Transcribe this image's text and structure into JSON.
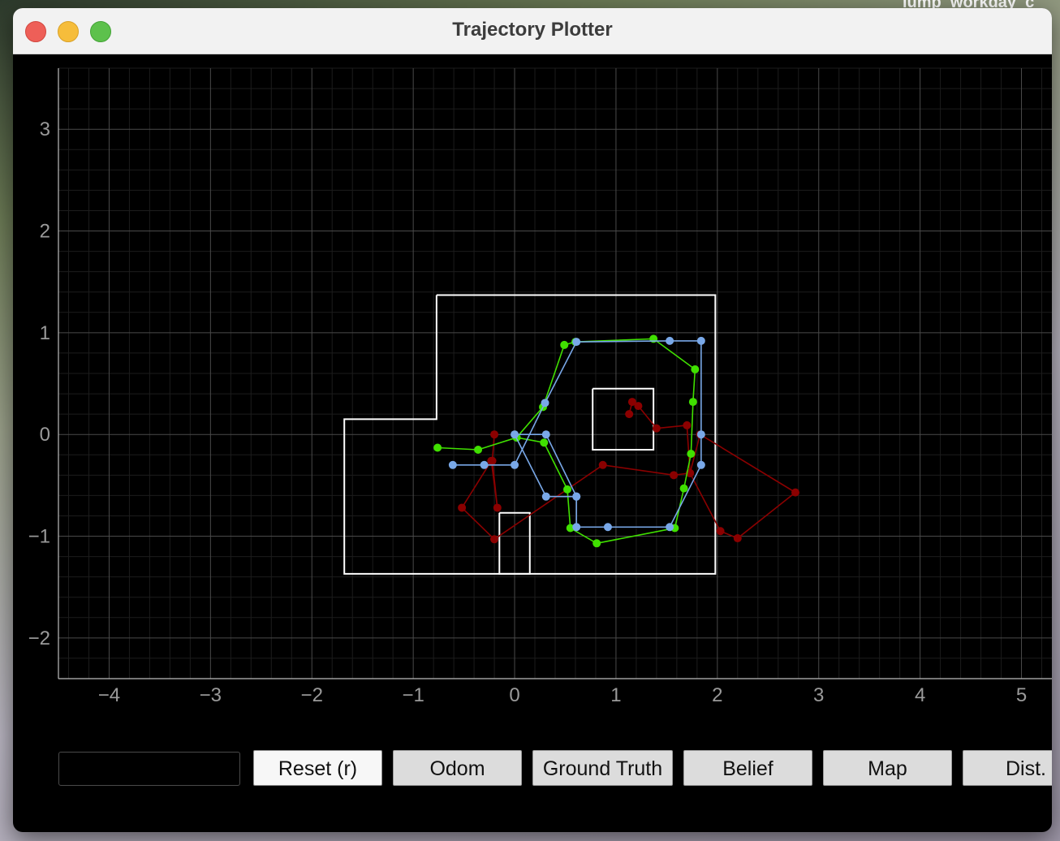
{
  "desktop": {
    "text": "lump_workday_c"
  },
  "window": {
    "title": "Trajectory Plotter"
  },
  "buttons": {
    "reset": "Reset (r)",
    "odom": "Odom",
    "ground_truth": "Ground Truth",
    "belief": "Belief",
    "map": "Map",
    "dist": "Dist."
  },
  "status_field": {
    "value": ""
  },
  "colors": {
    "odom": "#8b0000",
    "ground_truth": "#40e000",
    "belief": "#79a8e8",
    "map": "#ffffff",
    "grid_major": "#4a4a4a",
    "grid_minor": "#1c1c1c"
  },
  "chart_data": {
    "type": "line",
    "xlim": [
      -4.5,
      5.3
    ],
    "ylim": [
      -2.4,
      3.6
    ],
    "xticks": [
      -4,
      -3,
      -2,
      -1,
      0,
      1,
      2,
      3,
      4,
      5
    ],
    "yticks": [
      -2,
      -1,
      0,
      1,
      2,
      3
    ],
    "grid": true,
    "map_polygons": [
      [
        [
          -0.77,
          1.37
        ],
        [
          1.98,
          1.37
        ],
        [
          1.98,
          -1.37
        ],
        [
          -1.68,
          -1.37
        ],
        [
          -1.68,
          0.15
        ],
        [
          -0.77,
          0.15
        ],
        [
          -0.77,
          1.37
        ]
      ],
      [
        [
          0.77,
          0.45
        ],
        [
          1.37,
          0.45
        ],
        [
          1.37,
          -0.15
        ],
        [
          0.77,
          -0.15
        ],
        [
          0.77,
          0.45
        ]
      ],
      [
        [
          -0.15,
          -0.77
        ],
        [
          0.15,
          -0.77
        ],
        [
          0.15,
          -1.37
        ],
        [
          -0.15,
          -1.37
        ],
        [
          -0.15,
          -0.77
        ]
      ]
    ],
    "series": [
      {
        "key": "odom",
        "points": [
          [
            -0.2,
            0.0
          ],
          [
            -0.22,
            -0.26
          ],
          [
            -0.17,
            -0.72
          ],
          [
            -0.23,
            -0.26
          ],
          [
            -0.52,
            -0.72
          ],
          [
            -0.2,
            -1.03
          ],
          [
            0.87,
            -0.3
          ],
          [
            1.57,
            -0.4
          ],
          [
            1.73,
            -0.38
          ],
          [
            1.83,
            0.0
          ],
          [
            2.77,
            -0.57
          ],
          [
            2.2,
            -1.02
          ],
          [
            2.03,
            -0.95
          ],
          [
            1.73,
            -0.38
          ],
          [
            1.7,
            0.09
          ],
          [
            1.4,
            0.06
          ],
          [
            1.22,
            0.28
          ],
          [
            1.16,
            0.32
          ],
          [
            1.13,
            0.2
          ]
        ]
      },
      {
        "key": "ground_truth",
        "points": [
          [
            -0.76,
            -0.13
          ],
          [
            -0.36,
            -0.15
          ],
          [
            0.02,
            -0.03
          ],
          [
            0.29,
            -0.08
          ],
          [
            0.52,
            -0.54
          ],
          [
            0.55,
            -0.92
          ],
          [
            0.81,
            -1.07
          ],
          [
            1.58,
            -0.92
          ],
          [
            1.67,
            -0.53
          ],
          [
            1.74,
            -0.19
          ],
          [
            1.76,
            0.32
          ],
          [
            1.78,
            0.64
          ],
          [
            1.37,
            0.94
          ],
          [
            0.6,
            0.91
          ],
          [
            0.49,
            0.88
          ],
          [
            0.28,
            0.27
          ],
          [
            0.02,
            -0.03
          ]
        ]
      },
      {
        "key": "belief",
        "points": [
          [
            -0.61,
            -0.3
          ],
          [
            -0.3,
            -0.3
          ],
          [
            0.0,
            -0.3
          ],
          [
            0.3,
            0.31
          ],
          [
            0.61,
            0.91
          ],
          [
            1.53,
            0.92
          ],
          [
            1.84,
            0.92
          ],
          [
            1.84,
            0.0
          ],
          [
            1.84,
            -0.3
          ],
          [
            1.53,
            -0.91
          ],
          [
            0.92,
            -0.91
          ],
          [
            0.61,
            -0.91
          ],
          [
            0.61,
            -0.61
          ],
          [
            0.31,
            -0.61
          ],
          [
            0.0,
            0.0
          ],
          [
            0.31,
            0.0
          ],
          [
            0.61,
            -0.61
          ]
        ]
      }
    ]
  }
}
